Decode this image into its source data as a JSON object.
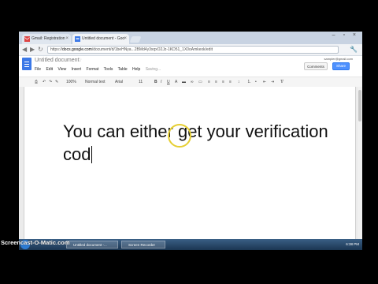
{
  "browser": {
    "tabs": [
      {
        "label": "Gmail: Registration"
      },
      {
        "label": "Untitled document - Goo"
      }
    ],
    "window_controls": "– ▫ ×",
    "nav_icons": [
      "back-icon",
      "forward-icon",
      "reload-icon"
    ],
    "url_scheme": "https://",
    "url_host": "docs.google.com",
    "url_path": "/document/d/1beHNya...2BMd4y3xqxO2Jz-1KD51_1X0oAmkexk/edit",
    "wrench_icon": "wrench-icon"
  },
  "docs": {
    "title": "Untitled document",
    "user_email": "sampler@gmail.com",
    "menu": [
      "File",
      "Edit",
      "View",
      "Insert",
      "Format",
      "Tools",
      "Table",
      "Help"
    ],
    "saving_status": "Saving...",
    "comments_label": "Comments",
    "share_label": "Share",
    "toolbar": {
      "zoom": "100%",
      "style": "Normal text",
      "font": "Arial",
      "size": "11"
    },
    "body": {
      "line1": "You can either get your verification",
      "line2": "cod"
    }
  },
  "taskbar": {
    "items": [
      "Untitled document -...",
      "Screen Recorder"
    ],
    "time": "6:38 PM"
  },
  "watermark": "Screencast-O-Matic.com",
  "colors": {
    "share_button": "#4d90fe",
    "doc_logo": "#3b78e7",
    "cursor_highlight": "#e6cf33"
  }
}
